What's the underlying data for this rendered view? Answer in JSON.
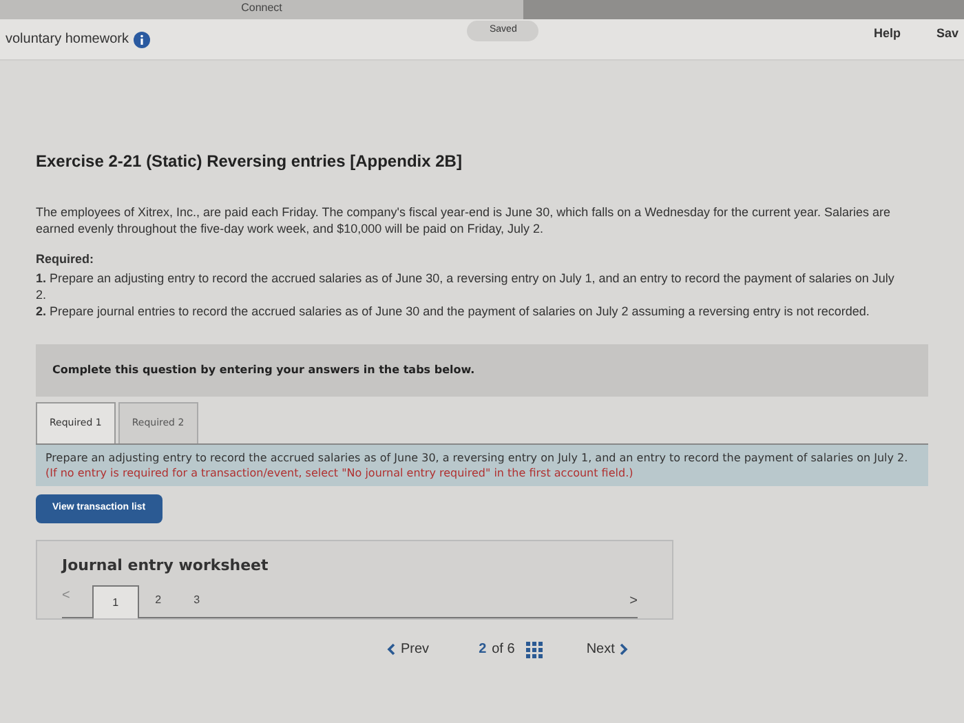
{
  "browser_tab": {
    "title": "Connect"
  },
  "header": {
    "title": "voluntary homework",
    "status": "Saved",
    "links": [
      "Help",
      "Sav"
    ]
  },
  "exercise": {
    "title": "Exercise 2-21 (Static) Reversing entries [Appendix 2B]",
    "intro": "The employees of Xitrex, Inc., are paid each Friday. The company's fiscal year-end is June 30, which falls on a Wednesday for the current year. Salaries are earned evenly throughout the five-day work week, and $10,000 will be paid on Friday, July 2.",
    "required_label": "Required:",
    "requirements": [
      "**1.** Prepare an adjusting entry to record the accrued salaries as of June 30, a reversing entry on July 1, and an entry to record the payment of salaries on July 2.",
      "**2.** Prepare journal entries to record the accrued salaries as of June 30 and the payment of salaries on July 2 assuming a reversing entry is not recorded."
    ]
  },
  "instruction_banner": "Complete this question by entering your answers in the tabs below.",
  "tabs": [
    {
      "label": "Required 1",
      "selected": true
    },
    {
      "label": "Required 2",
      "selected": false
    }
  ],
  "task": {
    "text": "Prepare an adjusting entry to record the accrued salaries as of June 30, a reversing entry on July 1, and an entry to record the payment of salaries on July 2.",
    "note": "(If no entry is required for a transaction/event, select \"No journal entry required\" in the first account field.)"
  },
  "view_button": "View transaction list",
  "worksheet": {
    "title": "Journal entry worksheet",
    "prev": "<",
    "next": ">",
    "pages": [
      {
        "label": "1",
        "selected": true
      },
      {
        "label": "2",
        "selected": false
      },
      {
        "label": "3",
        "selected": false
      }
    ]
  },
  "footer": {
    "prev": "Prev",
    "current": "2",
    "of": "of 6",
    "next": "Next"
  }
}
